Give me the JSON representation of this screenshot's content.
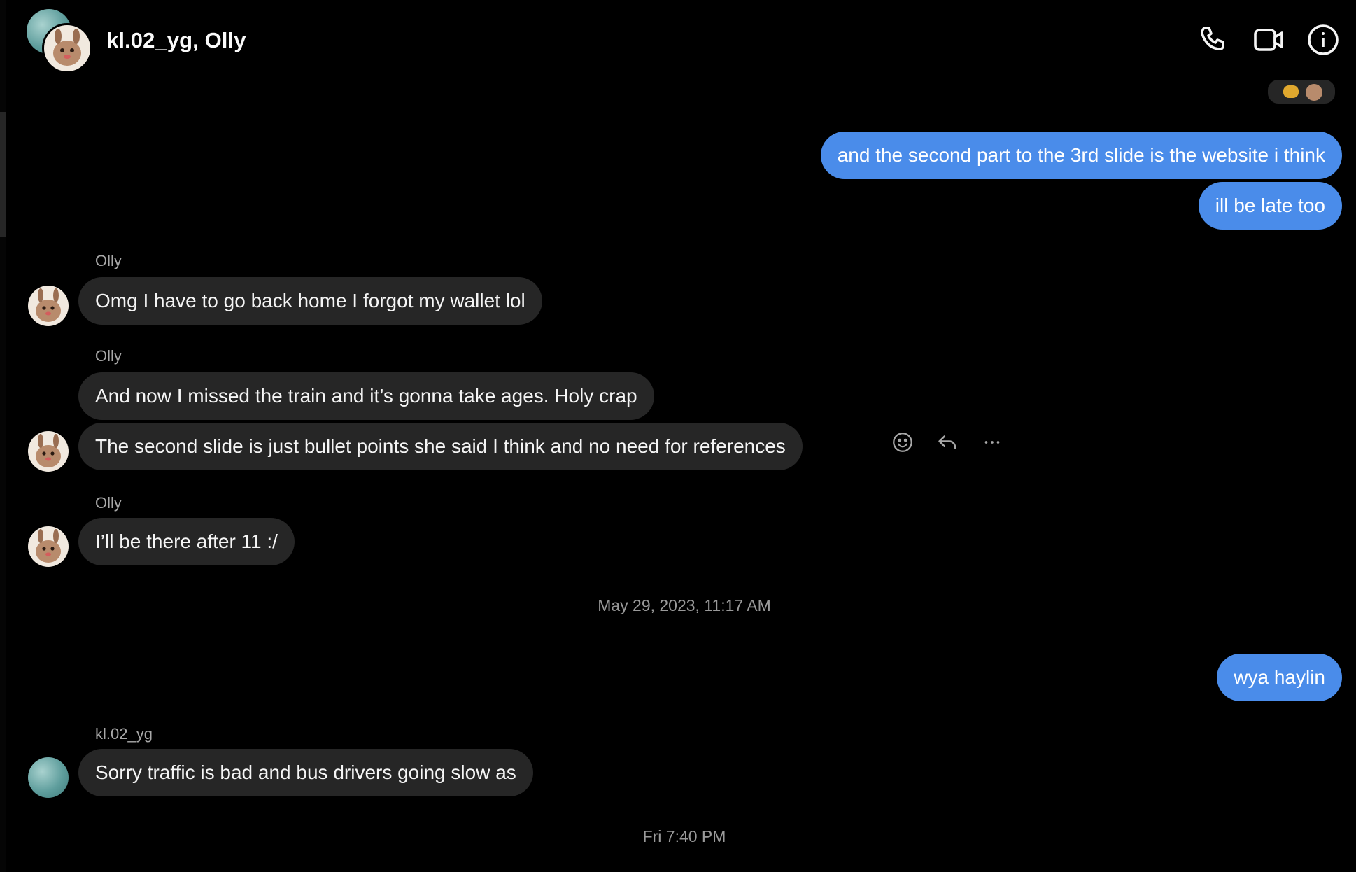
{
  "header": {
    "title": "kl.02_yg, Olly",
    "call_icon": "phone-icon",
    "video_icon": "video-camera-icon",
    "info_icon": "info-icon"
  },
  "messages": [
    {
      "direction": "out",
      "text": "and the second part to the 3rd slide is the website i think"
    },
    {
      "direction": "out",
      "text": "ill be late too"
    },
    {
      "direction": "in",
      "sender": "Olly",
      "text": "Omg I have to go back home I forgot my wallet lol"
    },
    {
      "direction": "in",
      "sender": "Olly",
      "text": "And now I missed the train and it’s gonna take ages. Holy crap"
    },
    {
      "direction": "in",
      "text": "The second slide is just bullet points she said I think and no need for references"
    },
    {
      "direction": "in",
      "sender": "Olly",
      "text": "I’ll be there after 11 :/"
    },
    {
      "direction": "out",
      "text": "wya haylin"
    },
    {
      "direction": "in",
      "sender": "kl.02_yg",
      "text": "Sorry traffic is bad and bus drivers going slow as"
    }
  ],
  "timestamps": [
    "May 29, 2023, 11:17 AM",
    "Fri 7:40 PM"
  ],
  "hover_actions": [
    "react-emoji-icon",
    "reply-icon",
    "more-options-icon"
  ],
  "colors": {
    "outgoing_bubble": "#4a8cea",
    "incoming_bubble": "#262626",
    "background": "#000000"
  }
}
